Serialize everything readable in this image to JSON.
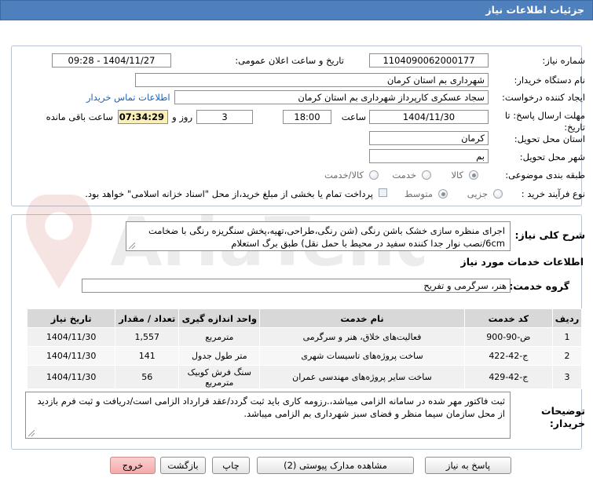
{
  "header": {
    "title": "جزئیات اطلاعات نیاز"
  },
  "info": {
    "need_number_label": "شماره نیاز:",
    "need_number": "1104090062000177",
    "announce_label": "تاریخ و ساعت اعلان عمومی:",
    "announce_value": "1404/11/27 - 09:28",
    "buyer_label": "نام دستگاه خریدار:",
    "buyer_value": "شهرداری بم استان کرمان",
    "requester_label": "ایجاد کننده درخواست:",
    "requester_value": "سجاد عسکری کارپرداز شهرداری بم استان کرمان",
    "contact_link": "اطلاعات تماس خریدار",
    "deadline_label": "مهلت ارسال پاسخ: تا تاریخ:",
    "deadline_date": "1404/11/30",
    "hour_label": "ساعت",
    "deadline_time": "18:00",
    "days_value": "3",
    "days_label": "روز و",
    "remaining_time": "07:34:29",
    "remaining_label": "ساعت باقی مانده",
    "province_label": "استان محل تحویل:",
    "province_value": "کرمان",
    "city_label": "شهر محل تحویل:",
    "city_value": "بم",
    "category_label": "طبقه بندی موضوعی:",
    "category_options": [
      "کالا",
      "خدمت",
      "کالا/خدمت"
    ],
    "process_label": "نوع فرآیند خرید :",
    "process_options": [
      "جزیی",
      "متوسط"
    ],
    "payment_note": "پرداخت تمام یا بخشی از مبلغ خرید،از محل \"اسناد خزانه اسلامی\" خواهد بود."
  },
  "description": {
    "label": "شرح کلی نیاز:",
    "text": "اجرای منظره سازی خشک باشن رنگی (شن رنگی،طراحی،تهیه،پخش سنگریزه رنگی با ضخامت 6cm/نصب نوار جدا کننده سفید در محیط با  حمل نقل) طبق برگ استعلام"
  },
  "services": {
    "section_title": "اطلاعات خدمات مورد نیاز",
    "group_label": "گروه خدمت:",
    "group_value": "هنر، سرگرمی و تفریح",
    "columns": [
      "ردیف",
      "کد خدمت",
      "نام خدمت",
      "واحد اندازه گیری",
      "تعداد / مقدار",
      "تاریخ نیاز"
    ],
    "rows": [
      [
        "1",
        "ض-90-900",
        "فعالیت‌های خلاق، هنر و سرگرمی",
        "مترمربع",
        "1,557",
        "1404/11/30"
      ],
      [
        "2",
        "ج-42-422",
        "ساخت پروژه‌های تاسیسات شهری",
        "متر طول جدول",
        "141",
        "1404/11/30"
      ],
      [
        "3",
        "ج-42-429",
        "ساخت سایر پروژه‌های مهندسی عمران",
        "سنگ فرش کوبیک مترمربع",
        "56",
        "1404/11/30"
      ]
    ]
  },
  "buyer_notes": {
    "label": "توضیحات خریدار:",
    "text": "ثبت فاکتور مهر شده در سامانه الزامی میباشد،.رزومه کاری باید ثبت گردد/عقد قرارداد الزامی است/دریافت و ثبت فرم بازدید از محل سازمان سیما منظر و فضای سبز شهرداری بم الزامی میباشد."
  },
  "buttons": {
    "reply": "پاسخ به نیاز",
    "attachments": "مشاهده مدارک پیوستی (2)",
    "print": "چاپ",
    "back": "بازگشت",
    "exit": "خروج"
  },
  "colors": {
    "title_bar": "#4d80bd",
    "link": "#2061b6",
    "time_bg": "#fbefb8",
    "exit_btn": "#f4a9a9"
  }
}
